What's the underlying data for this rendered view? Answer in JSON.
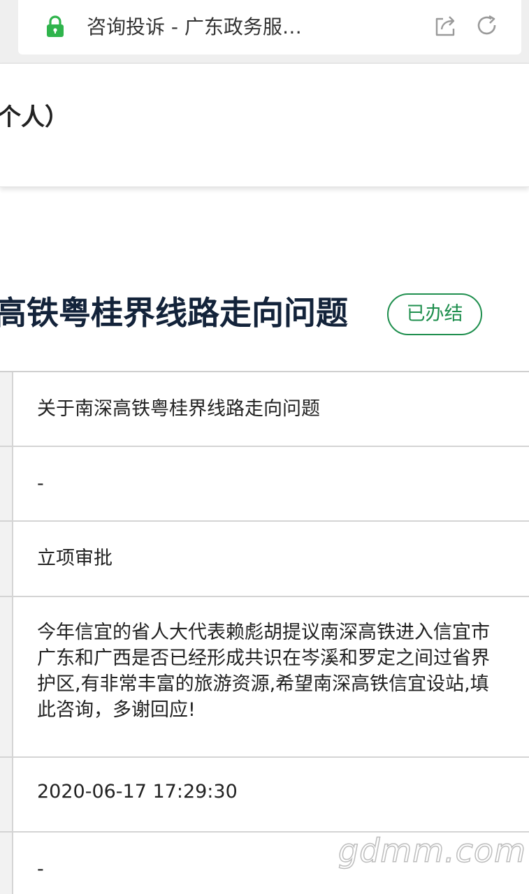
{
  "browser": {
    "tab_title": "咨询投诉 - 广东政务服…",
    "accent_color": "#2fb44c"
  },
  "header": {
    "title": "个人）"
  },
  "main": {
    "title": "高铁粤桂界线路走向问题",
    "status_badge": "已办结",
    "status_color": "#1f8f4e"
  },
  "details": {
    "rows": [
      {
        "value": "关于南深高铁粤桂界线路走向问题"
      },
      {
        "value": "-"
      },
      {
        "value": "立项审批"
      },
      {
        "lines": [
          "今年信宜的省人大代表赖彪胡提议南深高铁进入信宜市",
          "广东和广西是否已经形成共识在岑溪和罗定之间过省界",
          "护区,有非常丰富的旅游资源,希望南深高铁信宜设站,填",
          "此咨询，多谢回应!"
        ]
      },
      {
        "value": "2020-06-17 17:29:30"
      },
      {
        "value": "-"
      }
    ]
  },
  "watermark": "gdmm.com"
}
